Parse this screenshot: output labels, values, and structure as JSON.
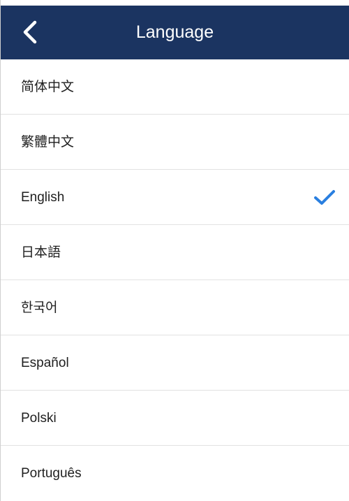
{
  "header": {
    "title": "Language",
    "back_icon": "chevron-left-icon",
    "background_color": "#1b3461"
  },
  "languages": [
    {
      "label": "简体中文",
      "selected": false
    },
    {
      "label": "繁體中文",
      "selected": false
    },
    {
      "label": "English",
      "selected": true
    },
    {
      "label": "日本語",
      "selected": false
    },
    {
      "label": "한국어",
      "selected": false
    },
    {
      "label": "Español",
      "selected": false
    },
    {
      "label": "Polski",
      "selected": false
    },
    {
      "label": "Português",
      "selected": false
    }
  ],
  "selected_icon": "checkmark-icon",
  "accent_color": "#2a7fe0"
}
